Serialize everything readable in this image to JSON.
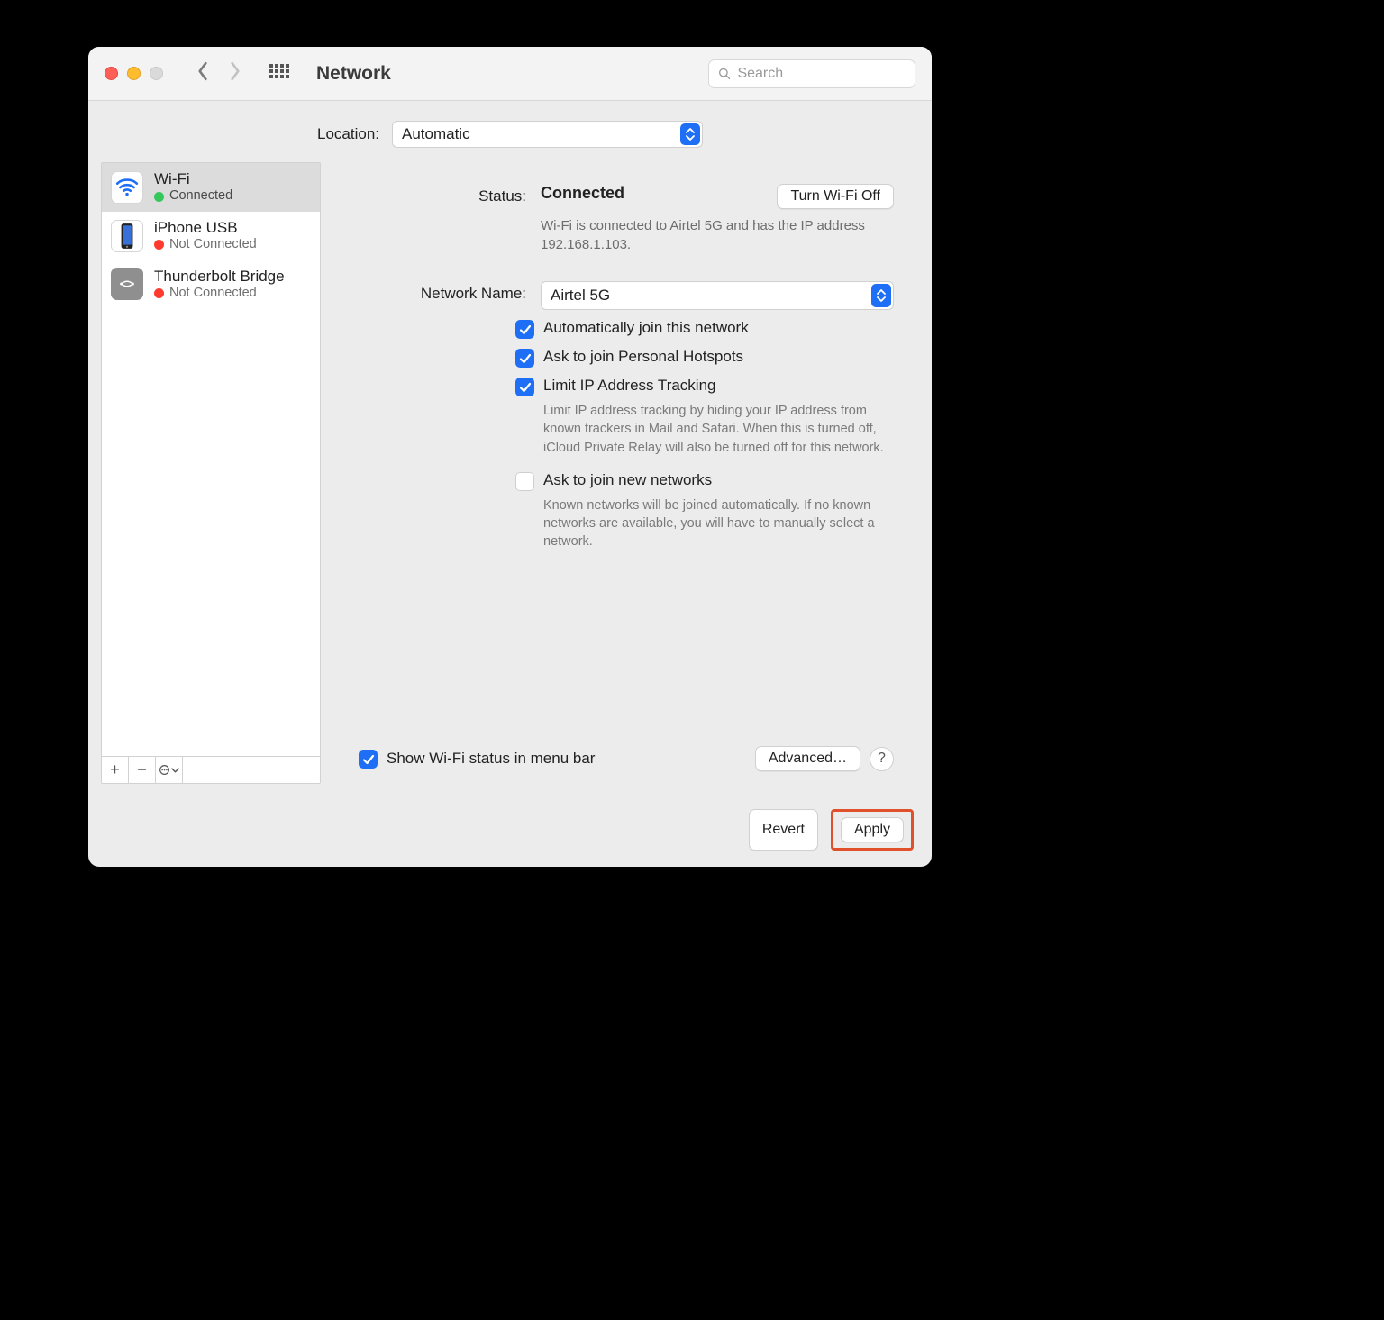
{
  "window": {
    "title": "Network",
    "search_placeholder": "Search"
  },
  "location": {
    "label": "Location:",
    "value": "Automatic"
  },
  "sidebar": {
    "items": [
      {
        "name": "Wi-Fi",
        "status": "Connected",
        "status_color": "green",
        "icon": "wifi",
        "selected": true
      },
      {
        "name": "iPhone USB",
        "status": "Not Connected",
        "status_color": "red",
        "icon": "iphone",
        "selected": false
      },
      {
        "name": "Thunderbolt Bridge",
        "status": "Not Connected",
        "status_color": "red",
        "icon": "thunderbolt",
        "selected": false
      }
    ],
    "footer": {
      "add": "+",
      "remove": "−",
      "more": "⊙⌄"
    }
  },
  "main": {
    "status_label": "Status:",
    "status_value": "Connected",
    "wifi_toggle": "Turn Wi-Fi Off",
    "status_desc": "Wi-Fi is connected to Airtel 5G and has the IP address 192.168.1.103.",
    "network_name_label": "Network Name:",
    "network_name_value": "Airtel 5G",
    "checks": {
      "auto_join": {
        "label": "Automatically join this network",
        "checked": true
      },
      "ask_hotspot": {
        "label": "Ask to join Personal Hotspots",
        "checked": true
      },
      "limit_ip": {
        "label": "Limit IP Address Tracking",
        "checked": true
      },
      "limit_ip_hint": "Limit IP address tracking by hiding your IP address from known trackers in Mail and Safari. When this is turned off, iCloud Private Relay will also be turned off for this network.",
      "ask_new": {
        "label": "Ask to join new networks",
        "checked": false
      },
      "ask_new_hint": "Known networks will be joined automatically. If no known networks are available, you will have to manually select a network."
    },
    "show_status": {
      "label": "Show Wi-Fi status in menu bar",
      "checked": true
    },
    "advanced": "Advanced…",
    "help": "?",
    "revert": "Revert",
    "apply": "Apply"
  }
}
